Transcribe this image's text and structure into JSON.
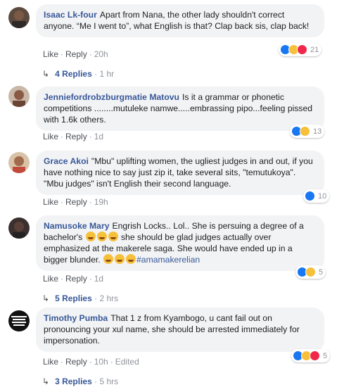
{
  "comments": [
    {
      "name": "Isaac Lk-four",
      "text": "Apart from Nana, the other lady shouldn't correct anyone. “Me I went to”, what English is that? Clap back sis, clap back!",
      "like": "Like",
      "reply": "Reply",
      "time": "20h",
      "reactions": [
        "like",
        "haha",
        "love"
      ],
      "reaction_count": "21",
      "replies_label": "4 Replies",
      "replies_time": "1 hr",
      "avatar_color": "#6b4a3a"
    },
    {
      "name": "Jenniefordrobzburgmatie Matovu",
      "text": "Is it a grammar or phonetic competitions ........mutuleke namwe.....embrassing pipo...feeling pissed with 1.6k others.",
      "like": "Like",
      "reply": "Reply",
      "time": "1d",
      "reactions": [
        "like",
        "haha"
      ],
      "reaction_count": "13",
      "avatar_color": "#8a5a44"
    },
    {
      "name": "Grace Akoi",
      "text": "\"Mbu\" uplifting women, the ugliest judges in and out, if you have nothing nice to say just zip it, take several sits, \"temutukoya\". \"Mbu judges\" isn't English their second language.",
      "like": "Like",
      "reply": "Reply",
      "time": "19h",
      "reactions": [
        "like"
      ],
      "reaction_count": "10",
      "avatar_color": "#a06a4c"
    },
    {
      "name": "Namusoke Mary",
      "text_parts": [
        "Engrish Locks.. Lol.. She is persuing a degree of a bachelor's ",
        " she should be glad judges actually over emphasized at the makerele saga. She would have ended up in a bigger blunder. "
      ],
      "hashtag": "#amamakerelian",
      "like": "Like",
      "reply": "Reply",
      "time": "1d",
      "reactions": [
        "like",
        "haha"
      ],
      "reaction_count": "5",
      "replies_label": "5 Replies",
      "replies_time": "2 hrs",
      "avatar_color": "#3b3030"
    },
    {
      "name": "Timothy Pumba",
      "text": "That 1 z from Kyambogo, u cant fail out on pronouncing your xul name, she should be arrested immediately for impersonation.",
      "like": "Like",
      "reply": "Reply",
      "time": "10h",
      "edited": "Edited",
      "reactions": [
        "like",
        "haha",
        "love"
      ],
      "reaction_count": "5",
      "replies_label": "3 Replies",
      "replies_time": "5 hrs",
      "avatar_color": "#111111",
      "avatar_text": "I AM NOT PARTIAL BOBI WINE"
    }
  ]
}
